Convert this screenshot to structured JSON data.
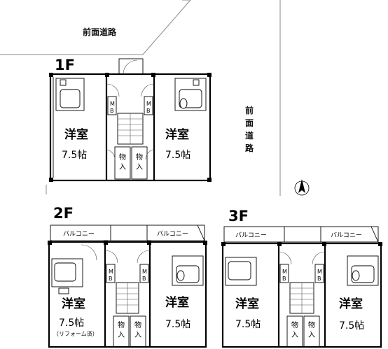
{
  "roads": {
    "top_label": "前面道路",
    "right_label": [
      "前",
      "面",
      "道",
      "路"
    ]
  },
  "compass": {
    "icon": "north-arrow-icon"
  },
  "floors": [
    {
      "label": "1F",
      "rooms": [
        {
          "type": "洋室",
          "size": "7.5帖",
          "note": ""
        },
        {
          "type": "洋室",
          "size": "7.5帖",
          "note": ""
        }
      ],
      "storage": [
        "物",
        "入",
        "物",
        "入"
      ],
      "mb": [
        "M",
        "B",
        "M",
        "B"
      ]
    },
    {
      "label": "2F",
      "balconies": [
        "バルコニー",
        "バルコニー"
      ],
      "rooms": [
        {
          "type": "洋室",
          "size": "7.5帖",
          "note": "（リフォーム済）"
        },
        {
          "type": "洋室",
          "size": "7.5帖",
          "note": ""
        }
      ],
      "storage": [
        "物",
        "入",
        "物",
        "入"
      ],
      "mb": [
        "M",
        "B",
        "M",
        "B"
      ]
    },
    {
      "label": "3F",
      "balconies": [
        "バルコニー",
        "バルコニー"
      ],
      "rooms": [
        {
          "type": "洋室",
          "size": "7.5帖",
          "note": ""
        },
        {
          "type": "洋室",
          "size": "7.5帖",
          "note": ""
        }
      ],
      "storage": [
        "物",
        "入",
        "物",
        "入"
      ],
      "mb": [
        "M",
        "B",
        "M",
        "B"
      ]
    }
  ],
  "colors": {
    "line": "#000000",
    "road": "#888888",
    "background": "#ffffff"
  }
}
